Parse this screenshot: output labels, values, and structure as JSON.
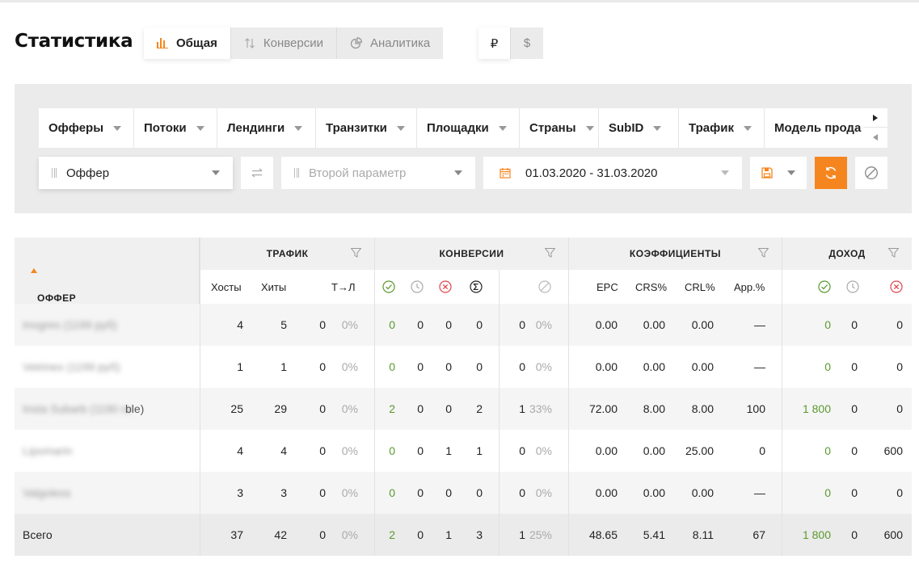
{
  "page": {
    "title": "Статистика"
  },
  "view_tabs": [
    {
      "label": "Общая",
      "icon": "bar-chart-icon",
      "active": true
    },
    {
      "label": "Конверсии",
      "icon": "sort-arrows-icon",
      "active": false
    },
    {
      "label": "Аналитика",
      "icon": "pie-chart-icon",
      "active": false
    }
  ],
  "currency": [
    {
      "label": "₽",
      "active": true
    },
    {
      "label": "$",
      "active": false
    }
  ],
  "filter_tabs": [
    "Офферы",
    "Потоки",
    "Лендинги",
    "Транзитки",
    "Площадки",
    "Страны",
    "SubID",
    "Трафик",
    "Модель прода"
  ],
  "controls": {
    "group_by": "Оффер",
    "second_param_placeholder": "Второй параметр",
    "date_range": "01.03.2020 - 31.03.2020"
  },
  "table": {
    "offer_header": "ОФФЕР",
    "groups": {
      "traffic": "ТРАФИК",
      "conversions": "КОНВЕРСИИ",
      "coefficients": "КОЭФФИЦИЕНТЫ",
      "income": "ДОХОД"
    },
    "sub_headers": {
      "hosts": "Хосты",
      "hits": "Хиты",
      "tl": "Т→Л",
      "epc": "EPC",
      "crs": "CRS%",
      "crl": "CRL%",
      "app": "App.%"
    },
    "rows": [
      {
        "name": "Inogres (1199 руб)",
        "name_suffix": "",
        "hosts": "4",
        "hits": "5",
        "tl": "0",
        "tl_pct": "0%",
        "c_ok": "0",
        "c_wait": "0",
        "c_rej": "0",
        "c_sum": "0",
        "c_trash": "0",
        "c_trash_pct": "0%",
        "epc": "0.00",
        "crs": "0.00",
        "crl": "0.00",
        "app": "—",
        "i_ok": "0",
        "i_wait": "0",
        "i_rej": "0"
      },
      {
        "name": "Vetrinex (1199 руб)",
        "name_suffix": "",
        "hosts": "1",
        "hits": "1",
        "tl": "0",
        "tl_pct": "0%",
        "c_ok": "0",
        "c_wait": "0",
        "c_rej": "0",
        "c_sum": "0",
        "c_trash": "0",
        "c_trash_pct": "0%",
        "epc": "0.00",
        "crs": "0.00",
        "crl": "0.00",
        "app": "—",
        "i_ok": "0",
        "i_wait": "0",
        "i_rej": "0"
      },
      {
        "name": "Insta Subarb (1190 ru",
        "name_suffix": "ble)",
        "hosts": "25",
        "hits": "29",
        "tl": "0",
        "tl_pct": "0%",
        "c_ok": "2",
        "c_wait": "0",
        "c_rej": "0",
        "c_sum": "2",
        "c_trash": "1",
        "c_trash_pct": "33%",
        "epc": "72.00",
        "crs": "8.00",
        "crl": "8.00",
        "app": "100",
        "i_ok": "1 800",
        "i_wait": "0",
        "i_rej": "0"
      },
      {
        "name": "Lipomarin",
        "name_suffix": "",
        "hosts": "4",
        "hits": "4",
        "tl": "0",
        "tl_pct": "0%",
        "c_ok": "0",
        "c_wait": "0",
        "c_rej": "1",
        "c_sum": "1",
        "c_trash": "0",
        "c_trash_pct": "0%",
        "epc": "0.00",
        "crs": "0.00",
        "crl": "25.00",
        "app": "0",
        "i_ok": "0",
        "i_wait": "0",
        "i_rej": "600"
      },
      {
        "name": "Valgoless",
        "name_suffix": "",
        "hosts": "3",
        "hits": "3",
        "tl": "0",
        "tl_pct": "0%",
        "c_ok": "0",
        "c_wait": "0",
        "c_rej": "0",
        "c_sum": "0",
        "c_trash": "0",
        "c_trash_pct": "0%",
        "epc": "0.00",
        "crs": "0.00",
        "crl": "0.00",
        "app": "—",
        "i_ok": "0",
        "i_wait": "0",
        "i_rej": "0"
      }
    ],
    "total": {
      "name": "Всего",
      "hosts": "37",
      "hits": "42",
      "tl": "0",
      "tl_pct": "0%",
      "c_ok": "2",
      "c_wait": "0",
      "c_rej": "1",
      "c_sum": "3",
      "c_trash": "1",
      "c_trash_pct": "25%",
      "epc": "48.65",
      "crs": "5.41",
      "crl": "8.11",
      "app": "67",
      "i_ok": "1 800",
      "i_wait": "0",
      "i_rej": "600"
    }
  },
  "colors": {
    "accent": "#f5861f",
    "positive": "#5a9a2e",
    "negative": "#e0474c"
  }
}
